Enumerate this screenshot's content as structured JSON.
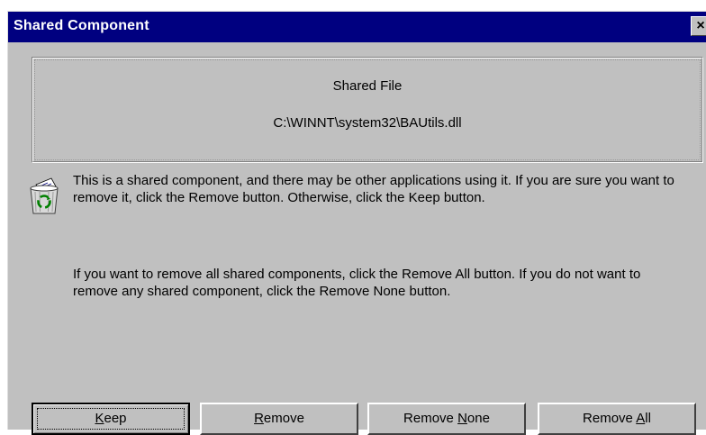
{
  "window": {
    "title": "Shared Component",
    "close_glyph": "×"
  },
  "file_group": {
    "heading": "Shared File",
    "path": "C:\\WINNT\\system32\\BAUtils.dll"
  },
  "icon": "recycle-bin-icon",
  "message": {
    "paragraph1": "This is a shared component, and there may be other applications using it.  If you are sure you want to remove it, click the Remove button.  Otherwise, click the Keep button.",
    "paragraph2": "If you want to remove all shared components, click the Remove All button.  If you do not want to remove any shared component, click the Remove None button."
  },
  "buttons": {
    "keep": {
      "label": "Keep",
      "mnemonic": "K"
    },
    "remove": {
      "label": "Remove",
      "mnemonic": "R"
    },
    "remove_none": {
      "label_prefix": "Remove ",
      "mnemonic": "N",
      "label_suffix": "one"
    },
    "remove_all": {
      "label_prefix": "Remove ",
      "mnemonic": "A",
      "label_suffix": "ll"
    }
  },
  "colors": {
    "titlebar": "#000080",
    "face": "#c0c0c0"
  }
}
